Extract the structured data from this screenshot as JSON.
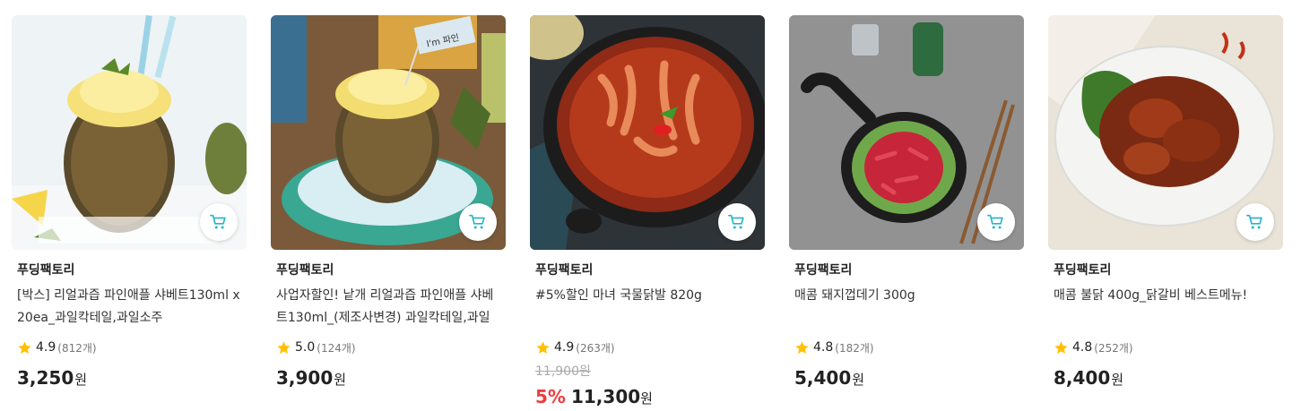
{
  "colors": {
    "accent": "#26b6c6",
    "star": "#ffc107",
    "sale": "#f03c3c"
  },
  "products": [
    {
      "brand": "푸딩팩토리",
      "title": "[박스] 리얼과즙 파인애플 샤베트130ml x 20ea_과일칵테일,과일소주",
      "score": "4.9",
      "count": "(812개)",
      "price": "3,250",
      "won": "원"
    },
    {
      "brand": "푸딩팩토리",
      "title": "사업자할인! 낱개 리얼과즙 파인애플 샤베트130ml_(제조사변경) 과일칵테일,과일",
      "score": "5.0",
      "count": "(124개)",
      "price": "3,900",
      "won": "원",
      "flag_text": "I'm 파인"
    },
    {
      "brand": "푸딩팩토리",
      "title": "#5%할인 마녀 국물닭발 820g",
      "score": "4.9",
      "count": "(263개)",
      "original_price": "11,900원",
      "discount": "5%",
      "price": "11,300",
      "won": "원"
    },
    {
      "brand": "푸딩팩토리",
      "title": "매콤 돼지껍데기 300g",
      "score": "4.8",
      "count": "(182개)",
      "price": "5,400",
      "won": "원"
    },
    {
      "brand": "푸딩팩토리",
      "title": "매콤 불닭 400g_닭갈비 베스트메뉴!",
      "score": "4.8",
      "count": "(252개)",
      "price": "8,400",
      "won": "원"
    }
  ]
}
